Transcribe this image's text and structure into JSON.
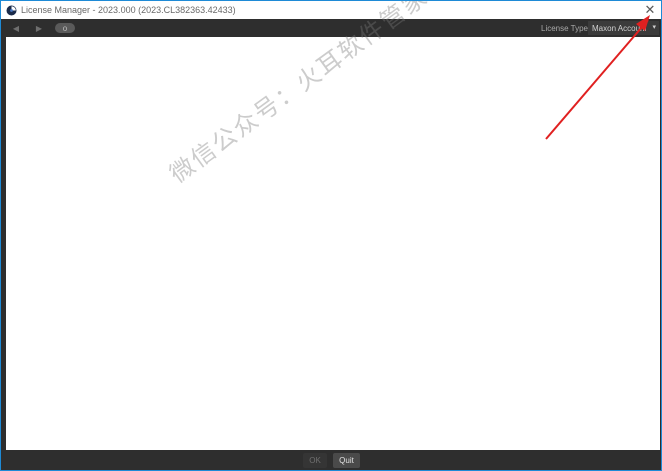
{
  "window": {
    "title": "License Manager - 2023.000 (2023.CL382363.42433)",
    "close_glyph": "✕",
    "accent_border": "#1e8ad6"
  },
  "toolbar": {
    "back_icon": "◀",
    "forward_icon": "▶",
    "refresh_icon": "o",
    "license_type_label": "License Type",
    "license_type_value": "Maxon Account",
    "dropdown_caret": "▾"
  },
  "watermark": {
    "text": "微信公众号：火耳软件管家"
  },
  "annotation": {
    "arrow_color": "#e02020"
  },
  "footer": {
    "ok_label": "OK",
    "quit_label": "Quit"
  }
}
